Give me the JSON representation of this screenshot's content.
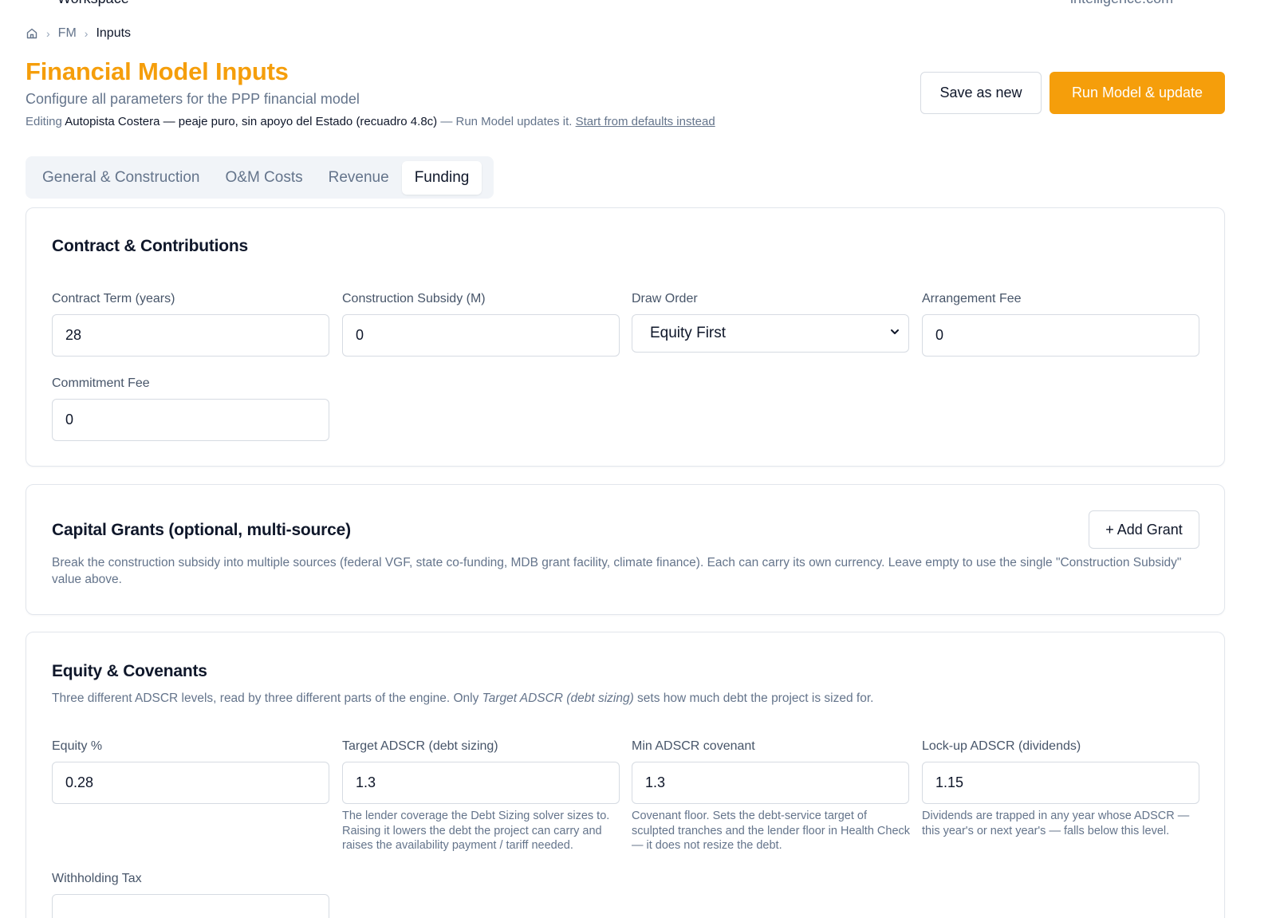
{
  "topbar": {
    "left_text": "Workspace",
    "right_text": "intelligence.com"
  },
  "breadcrumb": {
    "home_icon": "home-icon",
    "items": [
      "FM",
      "Inputs"
    ]
  },
  "header": {
    "title": "Financial Model Inputs",
    "subtitle": "Configure all parameters for the PPP financial model",
    "editing_prefix": "Editing",
    "scenario_name": "Autopista Costera — peaje puro, sin apoyo del Estado (recuadro 4.8c)",
    "editing_suffix": "— Run Model updates it.",
    "defaults_link": "Start from defaults instead",
    "save_as_new": "Save as new",
    "run_model": "Run Model & update"
  },
  "tabs": [
    "General & Construction",
    "O&M Costs",
    "Revenue",
    "Funding"
  ],
  "active_tab": "Funding",
  "contract": {
    "title": "Contract & Contributions",
    "contract_term": {
      "label": "Contract Term (years)",
      "value": "28"
    },
    "construction_subsidy": {
      "label": "Construction Subsidy (M)",
      "value": "0"
    },
    "draw_order": {
      "label": "Draw Order",
      "value": "Equity First"
    },
    "arrangement_fee": {
      "label": "Arrangement Fee",
      "value": "0"
    },
    "commitment_fee": {
      "label": "Commitment Fee",
      "value": "0"
    }
  },
  "grants": {
    "title": "Capital Grants (optional, multi-source)",
    "add_button": "+ Add Grant",
    "description": "Break the construction subsidy into multiple sources (federal VGF, state co-funding, MDB grant facility, climate finance). Each can carry its own currency. Leave empty to use the single \"Construction Subsidy\" value above."
  },
  "equity": {
    "title": "Equity & Covenants",
    "desc_before": "Three different ADSCR levels, read by three different parts of the engine. Only ",
    "desc_italic": "Target ADSCR (debt sizing)",
    "desc_after": " sets how much debt the project is sized for.",
    "equity_pct": {
      "label": "Equity %",
      "value": "0.28"
    },
    "target_adscr": {
      "label": "Target ADSCR (debt sizing)",
      "value": "1.3",
      "help": "The lender coverage the Debt Sizing solver sizes to. Raising it lowers the debt the project can carry and raises the availability payment / tariff needed."
    },
    "min_adscr": {
      "label": "Min ADSCR covenant",
      "value": "1.3",
      "help": "Covenant floor. Sets the debt-service target of sculpted tranches and the lender floor in Health Check — it does not resize the debt."
    },
    "lockup_adscr": {
      "label": "Lock-up ADSCR (dividends)",
      "value": "1.15",
      "help": "Dividends are trapped in any year whose ADSCR — this year's or next year's — falls below this level."
    },
    "withholding_tax": {
      "label": "Withholding Tax",
      "value": ""
    }
  },
  "colors": {
    "accent": "#f59e0b",
    "text": "#0f172a",
    "muted": "#64748b",
    "border": "#d6dbe2"
  }
}
